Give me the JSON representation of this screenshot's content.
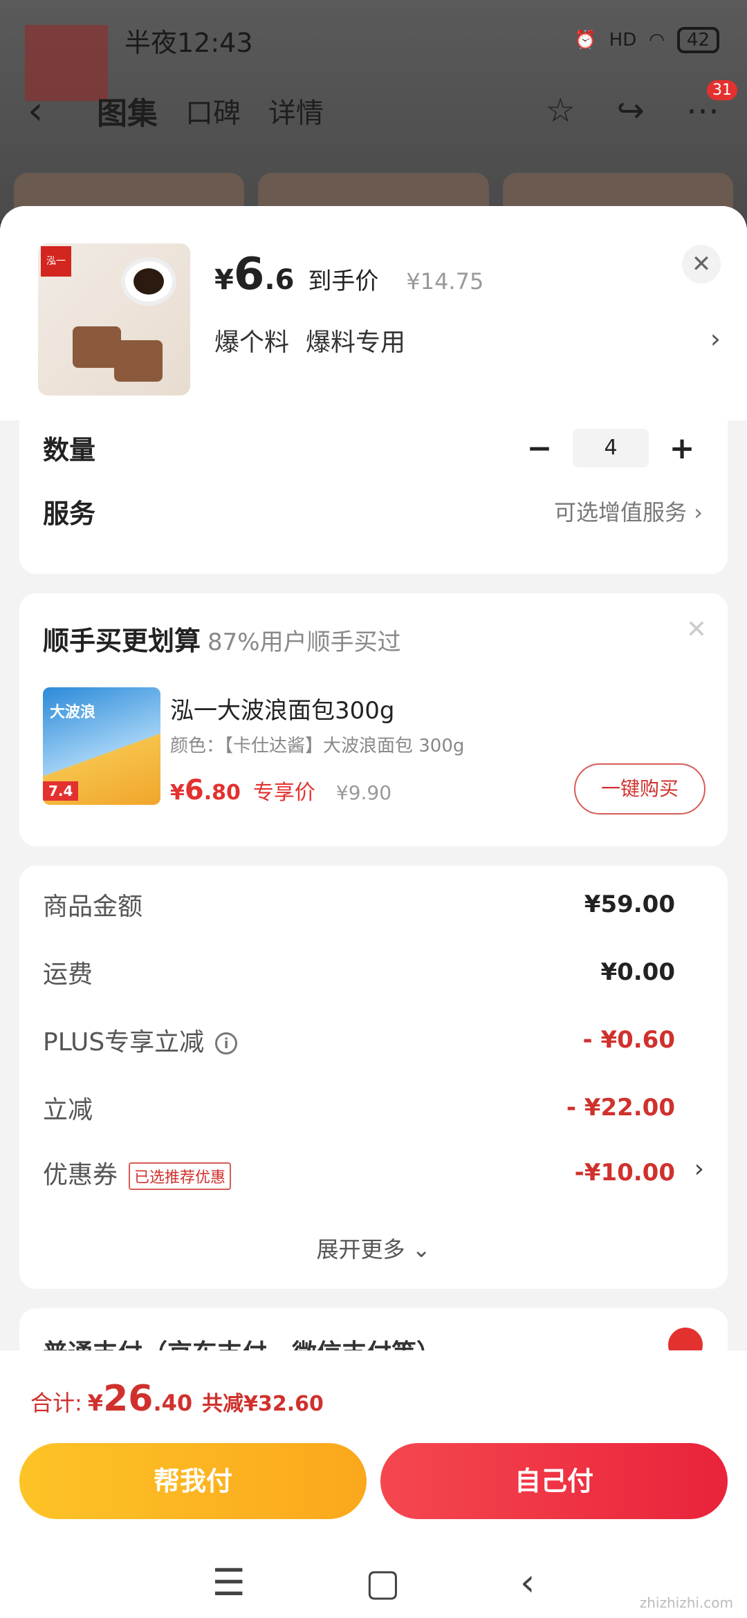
{
  "status_bar": {
    "time": "半夜12:43",
    "signal": "HD",
    "battery": "42"
  },
  "top_nav": {
    "tabs": [
      "图集",
      "口碑",
      "详情"
    ],
    "badge": "31"
  },
  "product": {
    "currency": "¥",
    "price_int": "6",
    "price_dec": ".6",
    "price_label": "到手价",
    "original_price": "¥14.75",
    "variant_1": "爆个料",
    "variant_2": "爆料专用"
  },
  "quantity": {
    "label": "数量",
    "value": "4",
    "minus": "−",
    "plus": "+"
  },
  "service": {
    "label": "服务",
    "value": "可选增值服务"
  },
  "bundle": {
    "title": "顺手买更划算",
    "subtitle": "87%用户顺手买过",
    "name": "泓一大波浪面包300g",
    "spec": "颜色：【卡仕达酱】大波浪面包 300g",
    "currency": "¥",
    "price_int": "6",
    "price_dec": ".80",
    "price_label": "专享价",
    "original_price": "¥9.90",
    "buy_label": "一键购买",
    "img_tag": "7.4",
    "img_text": "大波浪"
  },
  "summary": {
    "rows": [
      {
        "label": "商品金额",
        "value": "¥59.00"
      },
      {
        "label": "运费",
        "value": "¥0.00"
      },
      {
        "label": "PLUS专享立减",
        "value": "- ¥0.60"
      },
      {
        "label": "立减",
        "value": "- ¥22.00"
      },
      {
        "label": "优惠券",
        "value": "-¥10.00"
      }
    ],
    "coupon_tag": "已选推荐优惠",
    "expand": "展开更多"
  },
  "payment": {
    "title": "普通支付（京东支付、微信支付等）"
  },
  "footer": {
    "total_label": "合计:",
    "currency": "¥",
    "total_int": "26",
    "total_dec": ".40",
    "saved": "共减¥32.60",
    "help_pay": "帮我付",
    "self_pay": "自己付"
  },
  "watermark": "zhizhizhi.com"
}
